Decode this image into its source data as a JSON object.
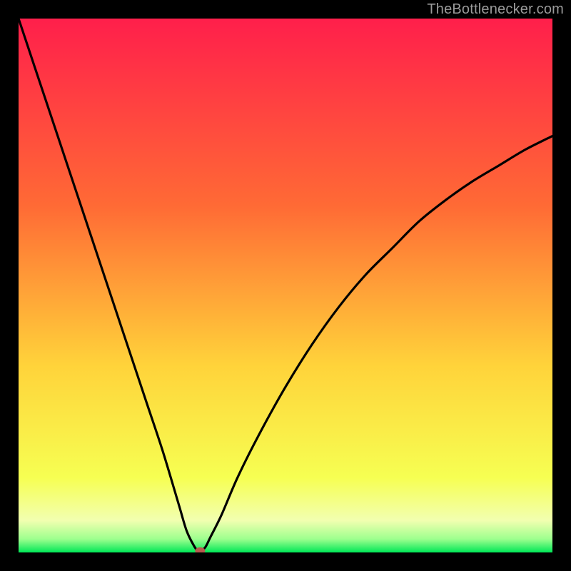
{
  "watermark": "TheBottlenecker.com",
  "colors": {
    "top": "#ff1f4b",
    "upper_mid": "#ff6a35",
    "mid": "#ffd33a",
    "lower_mid": "#f6ff52",
    "pale": "#f2ffb0",
    "green": "#00e756",
    "curve": "#000000",
    "marker": "#b85a4e",
    "frame": "#000000"
  },
  "chart_data": {
    "type": "line",
    "title": "",
    "xlabel": "",
    "ylabel": "",
    "xlim": [
      0,
      100
    ],
    "ylim": [
      0,
      100
    ],
    "series": [
      {
        "name": "bottleneck-curve",
        "x": [
          0,
          3,
          6,
          9,
          12,
          15,
          18,
          21,
          24,
          27,
          30,
          31.5,
          33,
          33.7,
          34.2,
          35,
          36,
          38,
          41,
          45,
          50,
          55,
          60,
          65,
          70,
          75,
          80,
          85,
          90,
          95,
          100
        ],
        "y": [
          100,
          91,
          82,
          73,
          64,
          55,
          46,
          37,
          28,
          19,
          9,
          4,
          1,
          0.3,
          0.3,
          1,
          3,
          7,
          14,
          22,
          31,
          39,
          46,
          52,
          57,
          62,
          66,
          69.5,
          72.5,
          75.5,
          78
        ]
      }
    ],
    "marker": {
      "name": "optimal-point",
      "x": 34,
      "y": 0.3
    },
    "gradient_bands": [
      {
        "from_y": 100,
        "to_y": 65,
        "description": "red"
      },
      {
        "from_y": 65,
        "to_y": 35,
        "description": "orange"
      },
      {
        "from_y": 35,
        "to_y": 12,
        "description": "yellow"
      },
      {
        "from_y": 12,
        "to_y": 3,
        "description": "pale-yellow"
      },
      {
        "from_y": 3,
        "to_y": 0,
        "description": "green"
      }
    ]
  }
}
